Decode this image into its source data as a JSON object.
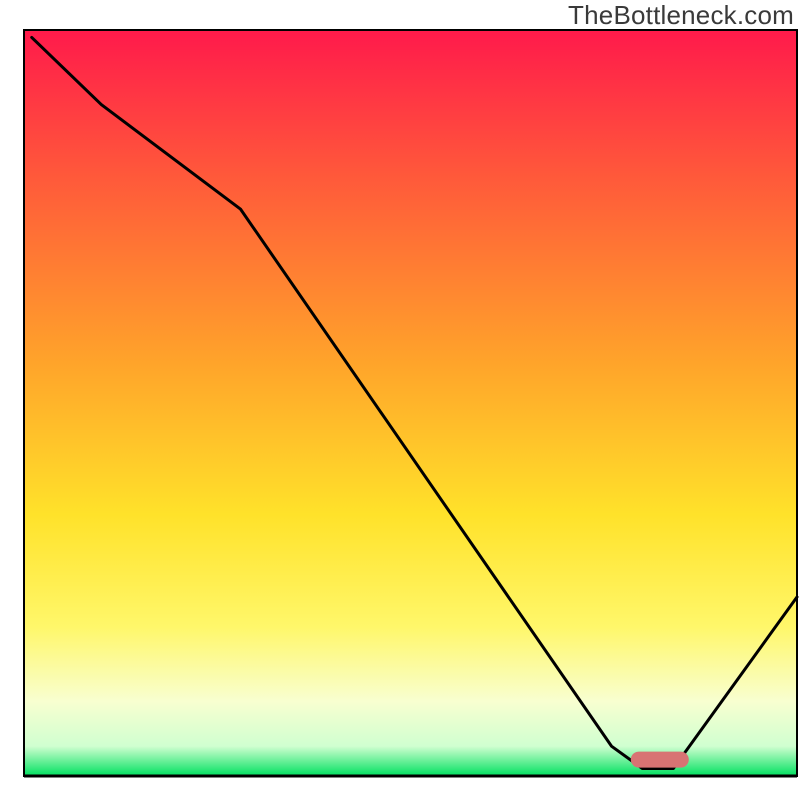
{
  "attribution": "TheBottleneck.com",
  "chart_data": {
    "type": "line",
    "title": "",
    "xlabel": "",
    "ylabel": "",
    "xlim": [
      0,
      100
    ],
    "ylim": [
      0,
      100
    ],
    "x": [
      1,
      10,
      28,
      76,
      80,
      84,
      100
    ],
    "values": [
      99,
      90,
      76,
      4,
      1,
      1,
      24
    ],
    "annotations": [],
    "sweet_range_x": [
      78.5,
      86
    ],
    "sweet_range_y": 2.2,
    "background": {
      "kind": "vertical-gradient",
      "stops": [
        {
          "y_pct": 0,
          "color": "#ff1a4b"
        },
        {
          "y_pct": 20,
          "color": "#ff5a3a"
        },
        {
          "y_pct": 45,
          "color": "#ffa52a"
        },
        {
          "y_pct": 65,
          "color": "#ffe22a"
        },
        {
          "y_pct": 80,
          "color": "#fff76a"
        },
        {
          "y_pct": 90,
          "color": "#f8ffd0"
        },
        {
          "y_pct": 96,
          "color": "#d0ffd0"
        },
        {
          "y_pct": 100,
          "color": "#00e060"
        }
      ]
    },
    "curve_color": "#000000",
    "curve_width": 3,
    "sweet_marker_color": "#d87373"
  }
}
